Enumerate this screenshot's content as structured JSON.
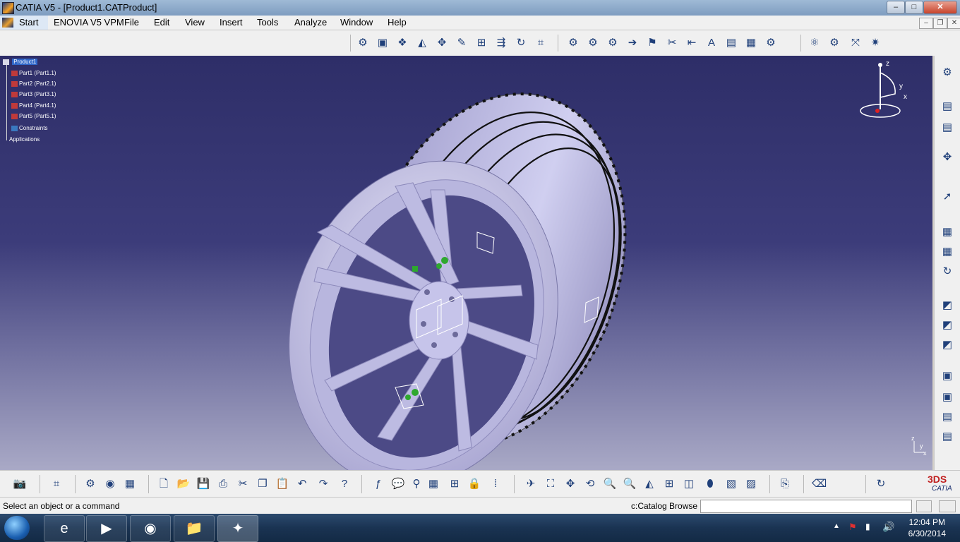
{
  "window": {
    "title": "CATIA V5 - [Product1.CATProduct]",
    "minimize": "–",
    "maximize": "□",
    "close": "✕"
  },
  "menu": {
    "start": "Start",
    "items": [
      "ENOVIA V5 VPM",
      "File",
      "Edit",
      "View",
      "Insert",
      "Tools",
      "Analyze",
      "Window",
      "Help"
    ]
  },
  "tree": {
    "root": "Product1",
    "parts": [
      "Part1 (Part1.1)",
      "Part2 (Part2.1)",
      "Part3 (Part3.1)",
      "Part4 (Part4.1)",
      "Part5 (Part5.1)"
    ],
    "constraints": "Constraints",
    "applications": "Applications"
  },
  "compass": {
    "z": "z",
    "y": "y",
    "x": "x"
  },
  "mini_axis": {
    "z": "z",
    "y": "y",
    "x": "x"
  },
  "catia_logo": "CATIA",
  "status": {
    "message": "Select an object or a command",
    "catalog": "c:Catalog Browse",
    "command_input": ""
  },
  "clock": {
    "time": "12:04 PM",
    "date": "6/30/2014"
  },
  "colors": {
    "viewport_top": "#2e2e68",
    "viewport_bottom": "#a9a9c6",
    "wheel": "#c8c6e8",
    "tire": "#bcbadf"
  }
}
